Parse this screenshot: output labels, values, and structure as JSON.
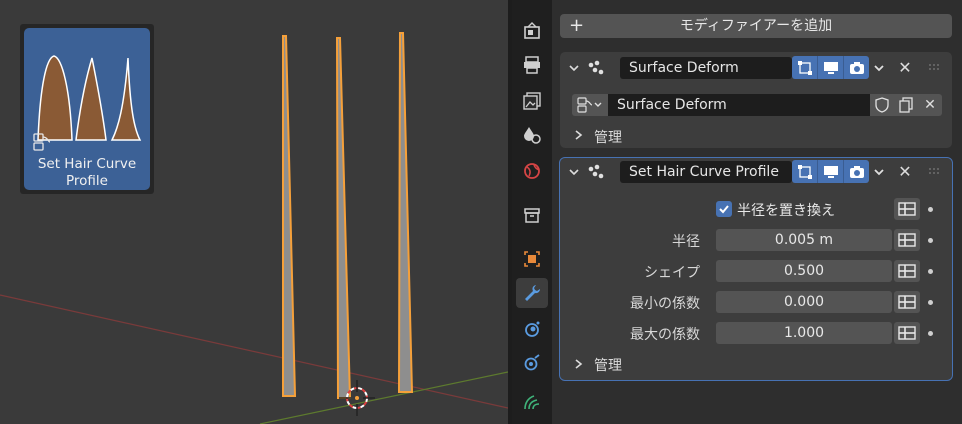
{
  "viewport": {
    "asset_label_line1": "Set Hair Curve",
    "asset_label_line2": "Profile"
  },
  "tabs": [
    {
      "icon": "render-icon"
    },
    {
      "icon": "output-icon"
    },
    {
      "icon": "view-layer-icon"
    },
    {
      "icon": "scene-icon"
    },
    {
      "icon": "world-icon"
    },
    {
      "icon": "collection-icon"
    },
    {
      "icon": "object-icon"
    },
    {
      "icon": "modifier-wrench-icon",
      "active": true
    },
    {
      "icon": "particles-icon"
    },
    {
      "icon": "physics-icon"
    },
    {
      "icon": "hair-curves-data-icon"
    }
  ],
  "modifiers": {
    "add_label": "モディファイアーを追加",
    "surface_deform": {
      "name": "Surface Deform",
      "node_group": "Surface Deform",
      "manage_label": "管理"
    },
    "set_hair": {
      "name": "Set Hair Curve Profile",
      "replace_radius_label": "半径を置き換え",
      "replace_radius_checked": true,
      "radius_label": "半径",
      "radius_value": "0.005 m",
      "shape_label": "シェイプ",
      "shape_value": "0.500",
      "min_factor_label": "最小の係数",
      "min_factor_value": "0.000",
      "max_factor_label": "最大の係数",
      "max_factor_value": "1.000",
      "manage_label": "管理"
    }
  },
  "colors": {
    "accent": "#4772b3",
    "selection_orange": "#f5a03a",
    "asset_card": "#3c6196"
  }
}
